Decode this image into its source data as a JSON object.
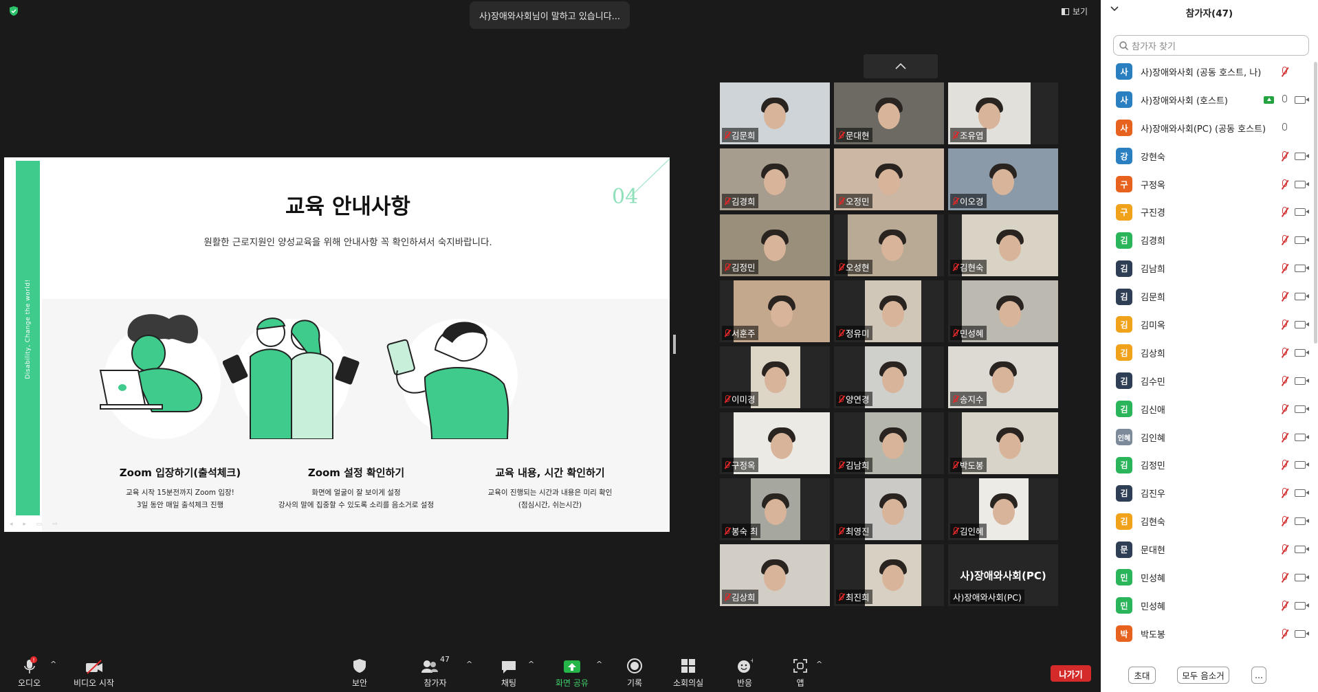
{
  "speaker_banner": "사)장애와사회님이 말하고 있습니다...",
  "view_label": "보기",
  "slide": {
    "title": "교육 안내사항",
    "subtitle": "원활한 근로지원인 양성교육을 위해 안내사항 꼭 확인하셔서 숙지바랍니다.",
    "page_num": "04",
    "side_text": "Disability, Change the world!",
    "items": [
      {
        "heading": "Zoom 입장하기(출석체크)",
        "line1": "교육 시작 15분전까지 Zoom 입장!",
        "line2": "3일 동안 매일 출석체크 진행"
      },
      {
        "heading": "Zoom 설정 확인하기",
        "line1": "화면에 얼굴이 잘 보이게 설정",
        "line2": "강사의 말에 집중할 수 있도록 소리를 음소거로 설정"
      },
      {
        "heading": "교육 내용, 시간 확인하기",
        "line1": "교육이 진행되는 시간과 내용은 미리 확인",
        "line2": "(점심시간, 쉬는시간)"
      }
    ]
  },
  "gallery": {
    "up_arrow": "^",
    "tiles": [
      "김문희",
      "문대현",
      "조유엽",
      "김경희",
      "오정민",
      "이오경",
      "김정민",
      "오성현",
      "김현숙",
      "서훈주",
      "정유미",
      "민성혜",
      "이미경",
      "양연경",
      "송지수",
      "구정옥",
      "김남희",
      "박도봉",
      "봉숙 최",
      "최영진",
      "김인혜",
      "김상희",
      "최진희"
    ],
    "pc_tile": {
      "big": "사)장애와사회(PC)",
      "label": "사)장애와사회(PC)"
    }
  },
  "participants": {
    "title": "참가자(47)",
    "search_placeholder": "참가자 찾기",
    "list": [
      {
        "avatar": "사",
        "color": "#2a7fc1",
        "name": "사)장애와사회 (공동 호스트, 나)",
        "mic": "muted",
        "cam": false,
        "share": false
      },
      {
        "avatar": "사",
        "color": "#2a7fc1",
        "name": "사)장애와사회 (호스트)",
        "mic": "on",
        "cam": true,
        "share": true
      },
      {
        "avatar": "사",
        "color": "#e8621f",
        "name": "사)장애와사회(PC) (공동 호스트)",
        "mic": "on",
        "cam": false,
        "share": false
      },
      {
        "avatar": "강",
        "color": "#2a7fc1",
        "name": "강현숙",
        "mic": "muted",
        "cam": true,
        "share": false
      },
      {
        "avatar": "구",
        "color": "#e8621f",
        "name": "구정옥",
        "mic": "muted",
        "cam": true,
        "share": false
      },
      {
        "avatar": "구",
        "color": "#f0a21b",
        "name": "구진경",
        "mic": "muted",
        "cam": true,
        "share": false
      },
      {
        "avatar": "김",
        "color": "#2bb55a",
        "name": "김경희",
        "mic": "muted",
        "cam": true,
        "share": false
      },
      {
        "avatar": "김",
        "color": "#2d3e55",
        "name": "김남희",
        "mic": "muted",
        "cam": true,
        "share": false
      },
      {
        "avatar": "김",
        "color": "#2d3e55",
        "name": "김문희",
        "mic": "muted",
        "cam": true,
        "share": false
      },
      {
        "avatar": "김",
        "color": "#f0a21b",
        "name": "김미옥",
        "mic": "muted",
        "cam": true,
        "share": false
      },
      {
        "avatar": "김",
        "color": "#f0a21b",
        "name": "김상희",
        "mic": "muted",
        "cam": true,
        "share": false
      },
      {
        "avatar": "김",
        "color": "#2d3e55",
        "name": "김수민",
        "mic": "muted",
        "cam": true,
        "share": false
      },
      {
        "avatar": "김",
        "color": "#2bb55a",
        "name": "김신애",
        "mic": "muted",
        "cam": true,
        "share": false
      },
      {
        "avatar": "인혜",
        "color": "#7c8a9a",
        "name": "김인혜",
        "mic": "muted",
        "cam": true,
        "share": false
      },
      {
        "avatar": "김",
        "color": "#2bb55a",
        "name": "김정민",
        "mic": "muted",
        "cam": true,
        "share": false
      },
      {
        "avatar": "김",
        "color": "#2d3e55",
        "name": "김진우",
        "mic": "muted",
        "cam": true,
        "share": false
      },
      {
        "avatar": "김",
        "color": "#f0a21b",
        "name": "김현숙",
        "mic": "muted",
        "cam": true,
        "share": false
      },
      {
        "avatar": "문",
        "color": "#2d3e55",
        "name": "문대현",
        "mic": "muted",
        "cam": true,
        "share": false
      },
      {
        "avatar": "민",
        "color": "#2bb55a",
        "name": "민성혜",
        "mic": "muted",
        "cam": true,
        "share": false
      },
      {
        "avatar": "민",
        "color": "#2bb55a",
        "name": "민성혜",
        "mic": "muted",
        "cam": true,
        "share": false
      },
      {
        "avatar": "박",
        "color": "#e8621f",
        "name": "박도봉",
        "mic": "muted",
        "cam": true,
        "share": false
      }
    ],
    "invite": "초대",
    "mute_all": "모두 음소거",
    "more": "..."
  },
  "toolbar": {
    "audio": "오디오",
    "video": "비디오 시작",
    "security": "보안",
    "participants": "참가자",
    "participants_count": "47",
    "chat": "채팅",
    "share": "화면 공유",
    "record": "기록",
    "breakout": "소회의실",
    "reactions": "반응",
    "apps": "앱",
    "leave": "나가기",
    "audio_badge": "!"
  }
}
